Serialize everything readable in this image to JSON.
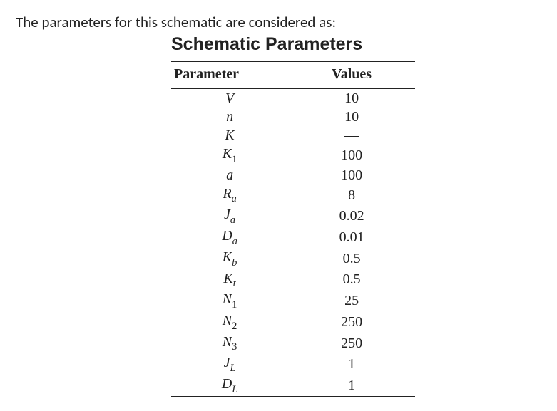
{
  "intro_text": "The parameters for this schematic are considered as:",
  "table": {
    "title": "Schematic Parameters",
    "headers": {
      "param": "Parameter",
      "values": "Values"
    },
    "rows": [
      {
        "param_base": "V",
        "param_sub": "",
        "sub_italic": false,
        "value": "10",
        "value_is_dash": false
      },
      {
        "param_base": "n",
        "param_sub": "",
        "sub_italic": false,
        "value": "10",
        "value_is_dash": false
      },
      {
        "param_base": "K",
        "param_sub": "",
        "sub_italic": false,
        "value": "",
        "value_is_dash": true
      },
      {
        "param_base": "K",
        "param_sub": "1",
        "sub_italic": false,
        "value": "100",
        "value_is_dash": false
      },
      {
        "param_base": "a",
        "param_sub": "",
        "sub_italic": false,
        "value": "100",
        "value_is_dash": false
      },
      {
        "param_base": "R",
        "param_sub": "a",
        "sub_italic": true,
        "value": "8",
        "value_is_dash": false
      },
      {
        "param_base": "J",
        "param_sub": "a",
        "sub_italic": true,
        "value": "0.02",
        "value_is_dash": false
      },
      {
        "param_base": "D",
        "param_sub": "a",
        "sub_italic": true,
        "value": "0.01",
        "value_is_dash": false
      },
      {
        "param_base": "K",
        "param_sub": "b",
        "sub_italic": true,
        "value": "0.5",
        "value_is_dash": false
      },
      {
        "param_base": "K",
        "param_sub": "t",
        "sub_italic": true,
        "value": "0.5",
        "value_is_dash": false
      },
      {
        "param_base": "N",
        "param_sub": "1",
        "sub_italic": false,
        "value": "25",
        "value_is_dash": false
      },
      {
        "param_base": "N",
        "param_sub": "2",
        "sub_italic": false,
        "value": "250",
        "value_is_dash": false
      },
      {
        "param_base": "N",
        "param_sub": "3",
        "sub_italic": false,
        "value": "250",
        "value_is_dash": false
      },
      {
        "param_base": "J",
        "param_sub": "L",
        "sub_italic": true,
        "value": "1",
        "value_is_dash": false
      },
      {
        "param_base": "D",
        "param_sub": "L",
        "sub_italic": true,
        "value": "1",
        "value_is_dash": false
      }
    ]
  }
}
